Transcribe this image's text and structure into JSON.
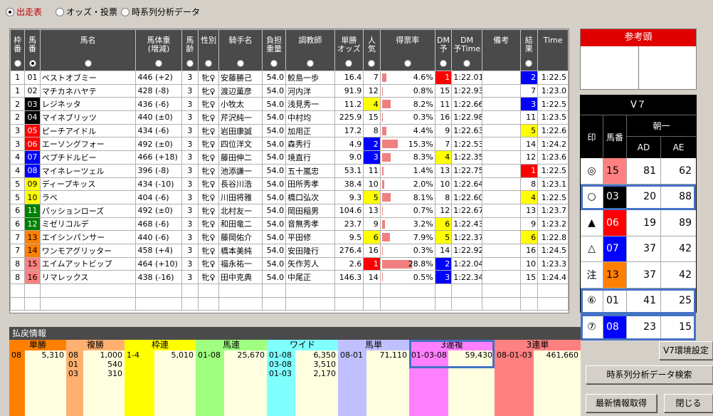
{
  "top_radios": [
    {
      "label": "出走表",
      "selected": true
    },
    {
      "label": "オッズ・投票",
      "selected": false
    },
    {
      "label": "時系列分析データ",
      "selected": false
    }
  ],
  "columns": [
    "枠番",
    "馬番",
    "馬名",
    "馬体重(増減)",
    "馬齢",
    "性別",
    "騎手名",
    "負担重量",
    "調教師",
    "単勝オッズ",
    "人気",
    "得票率",
    "DM予",
    "DM予Time",
    "備考",
    "結果",
    "Time"
  ],
  "header_labels": {
    "waku": [
      "枠",
      "番"
    ],
    "uma": [
      "馬",
      "番"
    ],
    "name": [
      "馬名"
    ],
    "weight": [
      "馬体重",
      "(増減)"
    ],
    "age": [
      "馬",
      "齢"
    ],
    "sex": [
      "性別"
    ],
    "jockey": [
      "騎手名"
    ],
    "load": [
      "負担",
      "重量"
    ],
    "trainer": [
      "調教師"
    ],
    "odds": [
      "単勝",
      "オッズ"
    ],
    "pop": [
      "人",
      "気"
    ],
    "rate": [
      "得票率"
    ],
    "dm": [
      "DM",
      "予"
    ],
    "dmt": [
      "DM",
      "予Time"
    ],
    "note": [
      "備考"
    ],
    "result": [
      "結",
      "果"
    ],
    "time": [
      "Time"
    ]
  },
  "horses": [
    {
      "waku": "1",
      "uma": "01",
      "name": "ベストオブミー",
      "weight": "446 (+2)",
      "age": "3",
      "sex": "牝♀",
      "jockey": "安藤勝己",
      "load": "54.0",
      "trainer": "鮫島一歩",
      "odds": "16.4",
      "pop": "7",
      "rate": "4.6%",
      "rate_v": 4.6,
      "dm": "1",
      "dmt": "1:22.01",
      "note": "",
      "result": "2",
      "time": "1:22.5"
    },
    {
      "waku": "1",
      "uma": "02",
      "name": "マチカネハヤテ",
      "weight": "428 (-8)",
      "age": "3",
      "sex": "牝♀",
      "jockey": "渡辺薫彦",
      "load": "54.0",
      "trainer": "河内洋",
      "odds": "91.9",
      "pop": "12",
      "rate": "0.8%",
      "rate_v": 0.8,
      "dm": "15",
      "dmt": "1:22.93",
      "note": "",
      "result": "7",
      "time": "1:23.0"
    },
    {
      "waku": "2",
      "uma": "03",
      "name": "レジネッタ",
      "weight": "436 (-6)",
      "age": "3",
      "sex": "牝♀",
      "jockey": "小牧太",
      "load": "54.0",
      "trainer": "浅見秀一",
      "odds": "11.2",
      "pop": "4",
      "rate": "8.2%",
      "rate_v": 8.2,
      "dm": "11",
      "dmt": "1:22.66",
      "note": "",
      "result": "3",
      "time": "1:22.5"
    },
    {
      "waku": "2",
      "uma": "04",
      "name": "マイネブリッツ",
      "weight": "440 (±0)",
      "age": "3",
      "sex": "牝♀",
      "jockey": "芹沢純一",
      "load": "54.0",
      "trainer": "中村均",
      "odds": "225.9",
      "pop": "15",
      "rate": "0.3%",
      "rate_v": 0.3,
      "dm": "16",
      "dmt": "1:22.98",
      "note": "",
      "result": "11",
      "time": "1:23.5"
    },
    {
      "waku": "3",
      "uma": "05",
      "name": "ピーチアイドル",
      "weight": "434 (-6)",
      "age": "3",
      "sex": "牝♀",
      "jockey": "岩田康誠",
      "load": "54.0",
      "trainer": "加用正",
      "odds": "17.2",
      "pop": "8",
      "rate": "4.4%",
      "rate_v": 4.4,
      "dm": "9",
      "dmt": "1:22.63",
      "note": "",
      "result": "5",
      "time": "1:22.6"
    },
    {
      "waku": "3",
      "uma": "06",
      "name": "エーソングフォー",
      "weight": "492 (±0)",
      "age": "3",
      "sex": "牝♀",
      "jockey": "四位洋文",
      "load": "54.0",
      "trainer": "森秀行",
      "odds": "4.9",
      "pop": "2",
      "rate": "15.3%",
      "rate_v": 15.3,
      "dm": "7",
      "dmt": "1:22.53",
      "note": "",
      "result": "14",
      "time": "1:24.2"
    },
    {
      "waku": "4",
      "uma": "07",
      "name": "ペプチドルビー",
      "weight": "466 (+18)",
      "age": "3",
      "sex": "牝♀",
      "jockey": "藤田伸二",
      "load": "54.0",
      "trainer": "境直行",
      "odds": "9.0",
      "pop": "3",
      "rate": "8.3%",
      "rate_v": 8.3,
      "dm": "4",
      "dmt": "1:22.35",
      "note": "",
      "result": "12",
      "time": "1:23.6"
    },
    {
      "waku": "4",
      "uma": "08",
      "name": "マイネレーツェル",
      "weight": "396 (-8)",
      "age": "3",
      "sex": "牝♀",
      "jockey": "池添謙一",
      "load": "54.0",
      "trainer": "五十嵐忠",
      "odds": "53.1",
      "pop": "11",
      "rate": "1.4%",
      "rate_v": 1.4,
      "dm": "13",
      "dmt": "1:22.75",
      "note": "",
      "result": "1",
      "time": "1:22.5"
    },
    {
      "waku": "5",
      "uma": "09",
      "name": "ディープキッス",
      "weight": "434 (-10)",
      "age": "3",
      "sex": "牝♀",
      "jockey": "長谷川浩",
      "load": "54.0",
      "trainer": "田所秀孝",
      "odds": "38.4",
      "pop": "10",
      "rate": "2.0%",
      "rate_v": 2.0,
      "dm": "10",
      "dmt": "1:22.64",
      "note": "",
      "result": "8",
      "time": "1:23.1"
    },
    {
      "waku": "5",
      "uma": "10",
      "name": "ラベ",
      "weight": "404 (-6)",
      "age": "3",
      "sex": "牝♀",
      "jockey": "川田将雅",
      "load": "54.0",
      "trainer": "橋口弘次",
      "odds": "9.3",
      "pop": "5",
      "rate": "8.1%",
      "rate_v": 8.1,
      "dm": "8",
      "dmt": "1:22.60",
      "note": "",
      "result": "4",
      "time": "1:22.5"
    },
    {
      "waku": "6",
      "uma": "11",
      "name": "パッションローズ",
      "weight": "492 (±0)",
      "age": "3",
      "sex": "牝♀",
      "jockey": "北村友一",
      "load": "54.0",
      "trainer": "岡田稲男",
      "odds": "104.6",
      "pop": "13",
      "rate": "0.7%",
      "rate_v": 0.7,
      "dm": "12",
      "dmt": "1:22.67",
      "note": "",
      "result": "13",
      "time": "1:23.7"
    },
    {
      "waku": "6",
      "uma": "12",
      "name": "ミゼリコルデ",
      "weight": "468 (-6)",
      "age": "3",
      "sex": "牝♀",
      "jockey": "和田竜二",
      "load": "54.0",
      "trainer": "音無秀孝",
      "odds": "23.7",
      "pop": "9",
      "rate": "3.2%",
      "rate_v": 3.2,
      "dm": "6",
      "dmt": "1:22.43",
      "note": "",
      "result": "9",
      "time": "1:23.2"
    },
    {
      "waku": "7",
      "uma": "13",
      "name": "エイシンパンサー",
      "weight": "440 (-6)",
      "age": "3",
      "sex": "牝♀",
      "jockey": "藤岡佑介",
      "load": "54.0",
      "trainer": "平田修",
      "odds": "9.5",
      "pop": "6",
      "rate": "7.9%",
      "rate_v": 7.9,
      "dm": "5",
      "dmt": "1:22.37",
      "note": "",
      "result": "6",
      "time": "1:22.8"
    },
    {
      "waku": "7",
      "uma": "14",
      "name": "ワンモアグリッター",
      "weight": "458 (+4)",
      "age": "3",
      "sex": "牝♀",
      "jockey": "橋本美純",
      "load": "54.0",
      "trainer": "安田隆行",
      "odds": "276.4",
      "pop": "16",
      "rate": "0.3%",
      "rate_v": 0.3,
      "dm": "14",
      "dmt": "1:22.92",
      "note": "",
      "result": "16",
      "time": "1:24.5"
    },
    {
      "waku": "8",
      "uma": "15",
      "name": "エイムアットビップ",
      "weight": "464 (+10)",
      "age": "3",
      "sex": "牝♀",
      "jockey": "福永祐一",
      "load": "54.0",
      "trainer": "矢作芳人",
      "odds": "2.6",
      "pop": "1",
      "rate": "28.8%",
      "rate_v": 28.8,
      "dm": "2",
      "dmt": "1:22.04",
      "note": "",
      "result": "10",
      "time": "1:23.3"
    },
    {
      "waku": "8",
      "uma": "16",
      "name": "リマレックス",
      "weight": "438 (-16)",
      "age": "3",
      "sex": "牝♀",
      "jockey": "田中克典",
      "load": "54.0",
      "trainer": "中尾正",
      "odds": "146.3",
      "pop": "14",
      "rate": "0.5%",
      "rate_v": 0.5,
      "dm": "3",
      "dmt": "1:22.34",
      "note": "",
      "result": "15",
      "time": "1:24.4"
    }
  ],
  "colors": {
    "waku": {
      "1": [
        "#ffffff",
        "#000"
      ],
      "2": [
        "#000000",
        "#fff"
      ],
      "3": [
        "#ff0000",
        "#fff"
      ],
      "4": [
        "#0000ff",
        "#fff"
      ],
      "5": [
        "#ffff00",
        "#000"
      ],
      "6": [
        "#008000",
        "#fff"
      ],
      "7": [
        "#ff8000",
        "#000"
      ],
      "8": [
        "#ff8080",
        "#000"
      ]
    },
    "pop": {
      "1": "#ff0000",
      "2": "#0000ff",
      "3": "#0000ff",
      "4": "#ffff00",
      "5": "#ffff00",
      "6": "#ffff00"
    },
    "dm": {
      "1": "#ff0000",
      "2": "#0000ff",
      "3": "#0000ff",
      "4": "#ffff00",
      "5": "#ffff00",
      "6": "#ffff00"
    },
    "result": {
      "1": "#ff0000",
      "2": "#0000ff",
      "3": "#0000ff",
      "4": "#ffff00",
      "5": "#ffff00",
      "6": "#ffff00"
    }
  },
  "sankou": {
    "title": "参考頭"
  },
  "v7": {
    "title": "V７",
    "sub": "朝一",
    "h_mark": "印",
    "h_uma": "馬番",
    "h_ad": "AD",
    "h_ae": "AE",
    "rows": [
      {
        "mark": "◎",
        "uma": "15",
        "ad": "81",
        "ae": "62",
        "bg": "#ff8080",
        "fg": "#000",
        "hl": false
      },
      {
        "mark": "○",
        "uma": "03",
        "ad": "20",
        "ae": "88",
        "bg": "#000000",
        "fg": "#fff",
        "hl": true
      },
      {
        "mark": "▲",
        "uma": "06",
        "ad": "19",
        "ae": "89",
        "bg": "#ff0000",
        "fg": "#fff",
        "hl": false
      },
      {
        "mark": "△",
        "uma": "07",
        "ad": "37",
        "ae": "42",
        "bg": "#0000ff",
        "fg": "#fff",
        "hl": false
      },
      {
        "mark": "注",
        "uma": "13",
        "ad": "37",
        "ae": "42",
        "bg": "#ff8000",
        "fg": "#000",
        "hl": false
      },
      {
        "mark": "⑥",
        "uma": "01",
        "ad": "41",
        "ae": "25",
        "bg": "#ffffff",
        "fg": "#000",
        "hl": true
      },
      {
        "mark": "⑦",
        "uma": "08",
        "ad": "23",
        "ae": "15",
        "bg": "#0000ff",
        "fg": "#fff",
        "hl": true
      }
    ]
  },
  "payout": {
    "title": "払戻情報",
    "cols": [
      {
        "name": "単勝",
        "color": "#ff8000",
        "w": 80,
        "lw": 22,
        "items": [
          [
            "08",
            "5,310"
          ]
        ]
      },
      {
        "name": "複勝",
        "color": "#ffb070",
        "w": 82,
        "lw": 24,
        "items": [
          [
            "08",
            "1,000"
          ],
          [
            "01",
            "540"
          ],
          [
            "03",
            "310"
          ]
        ]
      },
      {
        "name": "枠連",
        "color": "#ffff00",
        "w": 100,
        "lw": 42,
        "items": [
          [
            "1-4",
            "5,010"
          ]
        ]
      },
      {
        "name": "馬連",
        "color": "#a0ff80",
        "w": 100,
        "lw": 40,
        "items": [
          [
            "01-08",
            "25,670"
          ]
        ]
      },
      {
        "name": "ワイド",
        "color": "#80ffff",
        "w": 100,
        "lw": 40,
        "items": [
          [
            "01-08",
            "6,350"
          ],
          [
            "03-08",
            "3,510"
          ],
          [
            "01-03",
            "2,170"
          ]
        ]
      },
      {
        "name": "馬単",
        "color": "#c0c0ff",
        "w": 100,
        "lw": 40,
        "items": [
          [
            "08-01",
            "71,110"
          ]
        ]
      },
      {
        "name": "3連複",
        "color": "#ff80ff",
        "w": 120,
        "lw": 55,
        "items": [
          [
            "01-03-08",
            "59,430"
          ]
        ],
        "hl": true
      },
      {
        "name": "3連単",
        "color": "#ff8080",
        "w": 121,
        "lw": 55,
        "items": [
          [
            "08-01-03",
            "461,660"
          ]
        ]
      }
    ]
  },
  "buttons": {
    "v7env": "V7環境設定",
    "tsearch": "時系列分析データ検索",
    "refresh": "最新情報取得",
    "close": "閉じる"
  }
}
